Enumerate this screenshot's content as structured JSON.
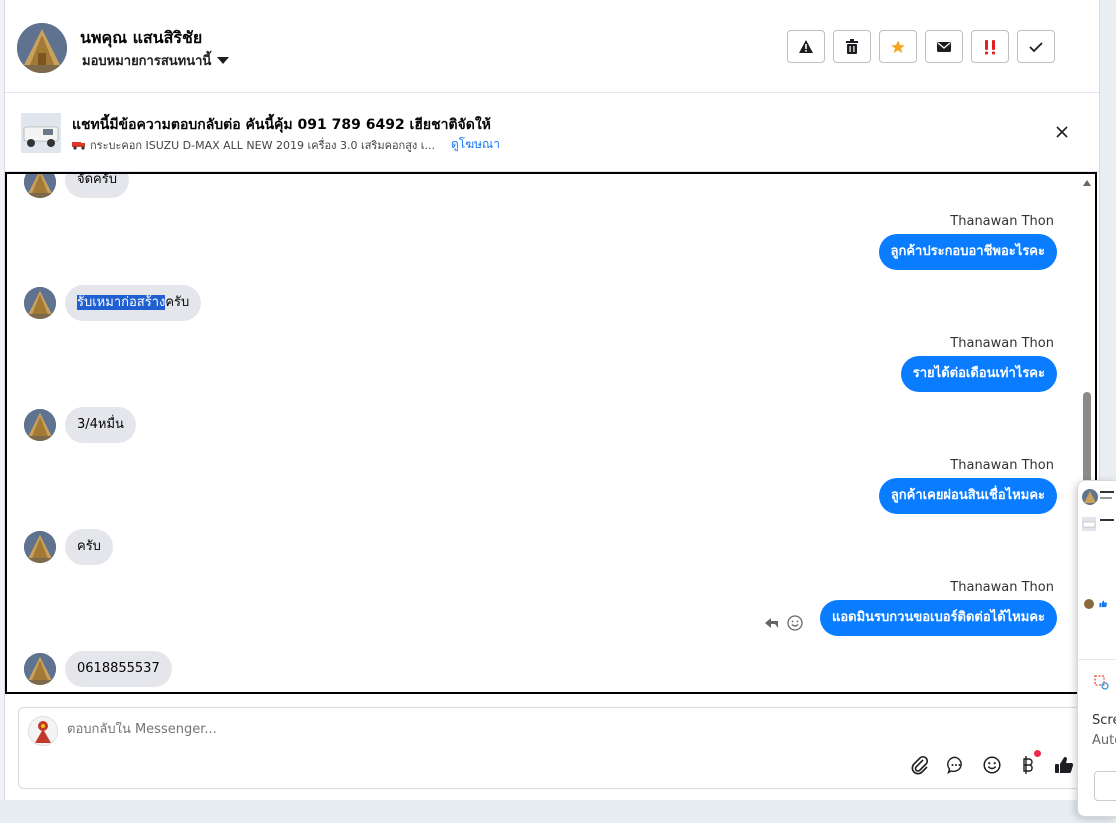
{
  "header": {
    "name": "นพคุณ แสนสิริชัย",
    "assign_label": "มอบหมายการสนทนานี้",
    "actions": [
      "report-icon",
      "trash-icon",
      "star-icon",
      "mail-icon",
      "important-icon",
      "done-icon"
    ]
  },
  "ad": {
    "title": "แชทนี้มีข้อความตอบกลับต่อ คันนี้คุ้ม 091 789 6492 เฮียชาติจัดให้",
    "subtitle": "กระบะคอก ISUZU D-MAX ALL NEW 2019 เครื่อง 3.0 เสริมคอกสูง เ...",
    "link": "ดูโฆษณา"
  },
  "messages": {
    "m0": "จัดครับ",
    "m1_sender": "Thanawan Thon",
    "m1": "ลูกค้าประกอบอาชีพอะไรคะ",
    "m2_selected": "รับเหมาก่อสร้าง",
    "m2_rest": "ครับ",
    "m3_sender": "Thanawan Thon",
    "m3": "รายได้ต่อเดือนเท่าไรคะ",
    "m4": "3/4หมื่น",
    "m5_sender": "Thanawan Thon",
    "m5": "ลูกค้าเคยผ่อนสินเชื่อไหมคะ",
    "m6": "ครับ",
    "m7_sender": "Thanawan Thon",
    "m7": "แอดมินรบกวนขอเบอร์ติดต่อได้ไหมคะ",
    "m8": "0618855537"
  },
  "composer": {
    "placeholder": "ตอบกลับใน Messenger..."
  },
  "side": {
    "text1": "Scre",
    "text2": "Auto"
  },
  "colors": {
    "outgoing_bubble": "#0a7cff",
    "incoming_bubble": "#e4e6eb",
    "selection": "#1f5fd1"
  }
}
